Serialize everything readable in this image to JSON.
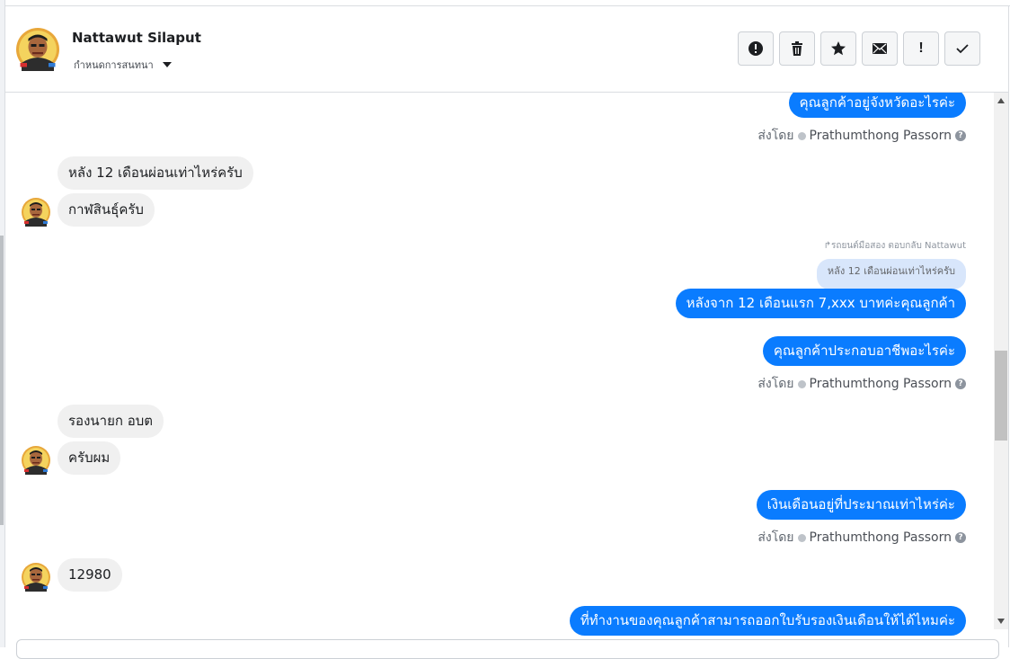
{
  "header": {
    "name": "Nattawut Silaput",
    "subtitle": "กำหนดการสนทนา",
    "toolbar": [
      {
        "icon": "alert-circle-icon",
        "name": "mark-spam-button"
      },
      {
        "icon": "trash-icon",
        "name": "delete-button"
      },
      {
        "icon": "star-icon",
        "name": "star-button"
      },
      {
        "icon": "envelope-icon",
        "name": "mark-unread-button"
      },
      {
        "icon": "exclamation-icon",
        "name": "follow-up-button"
      },
      {
        "icon": "check-icon",
        "name": "mark-done-button"
      }
    ]
  },
  "messages": {
    "m1": "คุณลูกค้าอยู่จังหวัดอะไรค่ะ",
    "m2": "หลัง 12 เดือนผ่อนเท่าไหร่ครับ",
    "m3": "กาฬสินธุ์ครับ",
    "m4_reply_note": "รถยนต์มือสอง ตอบกลับ Nattawut",
    "m4_quote": "หลัง 12 เดือนผ่อนเท่าไหร่ครับ",
    "m4": "หลังจาก 12 เดือนแรก 7,xxx บาทค่ะคุณลูกค้า",
    "m5": "คุณลูกค้าประกอบอาชีพอะไรค่ะ",
    "m6": "รองนายก อบต",
    "m7": "ครับผม",
    "m8": "เงินเดือนอยู่ที่ประมาณเท่าไหร่ค่ะ",
    "m9": "12980",
    "m10": "ที่ทำงานของคุณลูกค้าสามารถออกใบรับรองเงินเดือนให้ได้ไหมค่ะ"
  },
  "sent_by": {
    "prefix": "ส่งโดย",
    "agent": "Prathumthong Passorn",
    "help": "?"
  },
  "colors": {
    "outgoing_bubble": "#0a7cff",
    "incoming_bubble": "#f0f0f0",
    "quote_bubble": "#d8e6fb"
  }
}
